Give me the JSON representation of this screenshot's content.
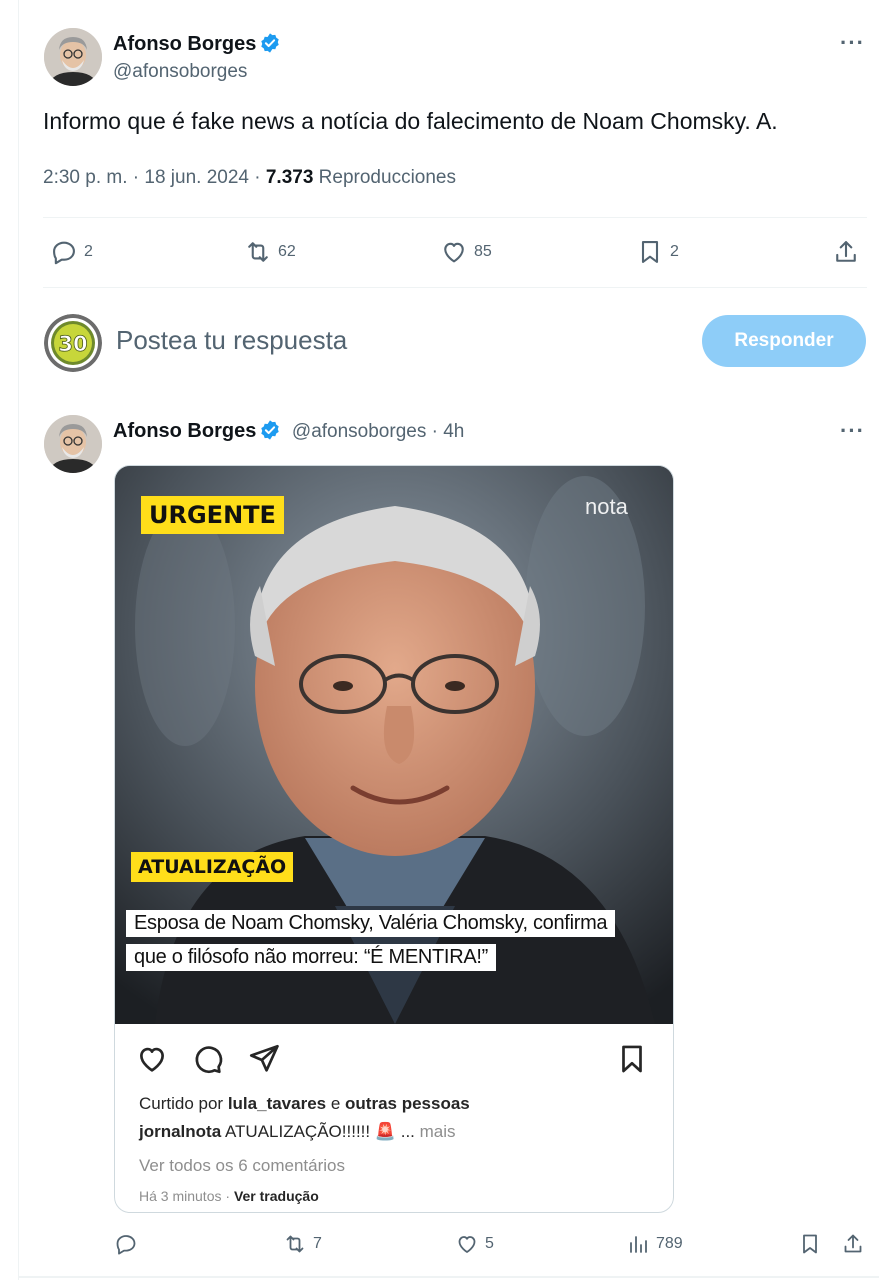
{
  "main_tweet": {
    "author_name": "Afonso Borges",
    "author_handle": "@afonsoborges",
    "text": "Informo que é fake news a notícia do falecimento de Noam Chomsky. A.",
    "timestamp": "2:30 p. m. · 18 jun. 2024 · ",
    "views_count": "7.373",
    "views_label": " Reproducciones",
    "more_label": "···",
    "actions": {
      "replies": "2",
      "retweets": "62",
      "likes": "85",
      "bookmarks": "2"
    }
  },
  "reply_box": {
    "avatar_label": "30",
    "placeholder": "Postea tu respuesta",
    "button_label": "Responder"
  },
  "reply_tweet": {
    "author_name": "Afonso Borges",
    "author_handle": "@afonsoborges",
    "time": " · 4h",
    "more_label": "···",
    "image": {
      "tag_top": "URGENTE",
      "logo": "nota",
      "tag_update": "ATUALIZAÇÃO",
      "caption_line1": "Esposa de Noam Chomsky, Valéria Chomsky, confirma",
      "caption_line2": "que o filósofo não morreu: “É MENTIRA!”"
    },
    "instagram": {
      "liked_prefix": "Curtido por ",
      "liked_user": "lula_tavares",
      "liked_middle": " e ",
      "liked_others": "outras pessoas",
      "caption_user": "jornalnota",
      "caption_text": " ATUALIZAÇÃO!!!!!! 🚨",
      "caption_more_ellipsis": " ... ",
      "caption_more": "mais",
      "comments_link": "Ver todos os 6 comentários",
      "time_ago": "Há 3 minutos",
      "translate_sep": " · ",
      "translate": "Ver tradução"
    },
    "actions": {
      "replies": "",
      "retweets": "7",
      "likes": "5",
      "views": "789"
    }
  },
  "colors": {
    "accent": "#1d9bf0",
    "button_disabled": "#8ecdf8",
    "secondary_text": "#536471",
    "badge_yellow": "#ffde1a"
  },
  "icons": [
    "verified-badge-icon",
    "more-icon",
    "reply-icon",
    "retweet-icon",
    "like-icon",
    "bookmark-icon",
    "share-icon",
    "views-icon",
    "ig-heart-icon",
    "ig-comment-icon",
    "ig-send-icon",
    "ig-save-icon"
  ]
}
